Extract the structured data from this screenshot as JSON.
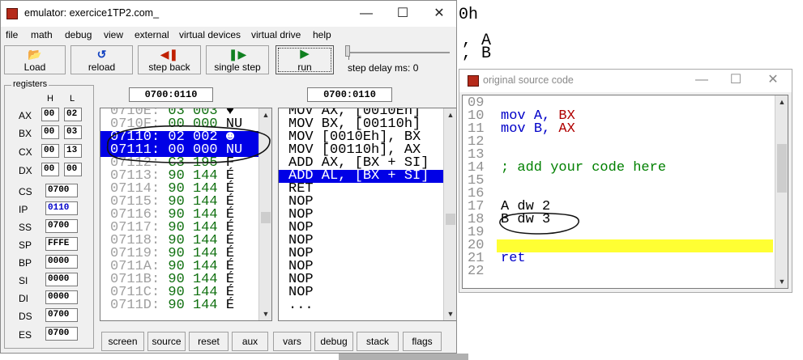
{
  "background": {
    "line1": "0h",
    "line2": ", A",
    "line3": ", B"
  },
  "emulator": {
    "title": "emulator: exercice1TP2.com_",
    "controls": {
      "minimize": "—",
      "maximize": "☐",
      "close": "✕"
    },
    "menu": [
      "file",
      "math",
      "debug",
      "view",
      "external",
      "virtual devices",
      "virtual drive",
      "help"
    ],
    "toolbar": {
      "load": "Load",
      "reload": "reload",
      "step_back": "step back",
      "single_step": "single step",
      "run": "run",
      "step_delay": "step delay ms: 0"
    },
    "registers": {
      "group_label": "registers",
      "h_label": "H",
      "l_label": "L",
      "pairs": [
        {
          "name": "AX",
          "h": "00",
          "l": "02"
        },
        {
          "name": "BX",
          "h": "00",
          "l": "03"
        },
        {
          "name": "CX",
          "h": "00",
          "l": "13"
        },
        {
          "name": "DX",
          "h": "00",
          "l": "00"
        }
      ],
      "segments": [
        {
          "name": "CS",
          "value": "0700"
        },
        {
          "name": "IP",
          "value": "0110"
        },
        {
          "name": "SS",
          "value": "0700"
        },
        {
          "name": "SP",
          "value": "FFFE"
        },
        {
          "name": "BP",
          "value": "0000"
        },
        {
          "name": "SI",
          "value": "0000"
        },
        {
          "name": "DI",
          "value": "0000"
        },
        {
          "name": "DS",
          "value": "0700"
        },
        {
          "name": "ES",
          "value": "0700"
        }
      ]
    },
    "memory_address": "0700:0110",
    "disasm_address": "0700:0110",
    "memory_rows": [
      {
        "addr": "0710E:",
        "b": "03",
        "d": "003",
        "c": "♥"
      },
      {
        "addr": "0710F:",
        "b": "00",
        "d": "000",
        "c": "NU"
      },
      {
        "addr": "07110:",
        "b": "02",
        "d": "002",
        "c": "☻"
      },
      {
        "addr": "07111:",
        "b": "00",
        "d": "000",
        "c": "NU"
      },
      {
        "addr": "07112:",
        "b": "C3",
        "d": "195",
        "c": "F"
      },
      {
        "addr": "07113:",
        "b": "90",
        "d": "144",
        "c": "É"
      },
      {
        "addr": "07114:",
        "b": "90",
        "d": "144",
        "c": "É"
      },
      {
        "addr": "07115:",
        "b": "90",
        "d": "144",
        "c": "É"
      },
      {
        "addr": "07116:",
        "b": "90",
        "d": "144",
        "c": "É"
      },
      {
        "addr": "07117:",
        "b": "90",
        "d": "144",
        "c": "É"
      },
      {
        "addr": "07118:",
        "b": "90",
        "d": "144",
        "c": "É"
      },
      {
        "addr": "07119:",
        "b": "90",
        "d": "144",
        "c": "É"
      },
      {
        "addr": "0711A:",
        "b": "90",
        "d": "144",
        "c": "É"
      },
      {
        "addr": "0711B:",
        "b": "90",
        "d": "144",
        "c": "É"
      },
      {
        "addr": "0711C:",
        "b": "90",
        "d": "144",
        "c": "É"
      },
      {
        "addr": "0711D:",
        "b": "90",
        "d": "144",
        "c": "É"
      }
    ],
    "disasm_rows": [
      "MOV AX, [0010Eh]",
      "MOV BX, [00110h]",
      "MOV [0010Eh], BX",
      "MOV [00110h], AX",
      "ADD AX, [BX + SI]",
      "ADD AL, [BX + SI]",
      "RET",
      "NOP",
      "NOP",
      "NOP",
      "NOP",
      "NOP",
      "NOP",
      "NOP",
      "NOP",
      "..."
    ],
    "bottom_buttons": [
      "screen",
      "source",
      "reset",
      "aux",
      "vars",
      "debug",
      "stack",
      "flags"
    ]
  },
  "source": {
    "title": "original source code",
    "controls": {
      "minimize": "—",
      "maximize": "☐",
      "close": "✕"
    },
    "line_numbers": [
      "09",
      "10",
      "11",
      "12",
      "13",
      "14",
      "15",
      "16",
      "17",
      "18",
      "19",
      "20",
      "21",
      "22"
    ],
    "lines": {
      "l10_kw": "mov",
      "l10_op": "A, ",
      "l10_reg": "BX",
      "l11_kw": "mov",
      "l11_op": "B, ",
      "l11_reg": "AX",
      "l14": "; add your code here",
      "l17": "A dw 2",
      "l18": "B dw 3",
      "l21": "ret"
    }
  },
  "colors": {
    "selection": "#0000e6",
    "highlight": "#ffff33",
    "keyword": "#0000c8",
    "register": "#b00000",
    "comment": "#008000"
  }
}
